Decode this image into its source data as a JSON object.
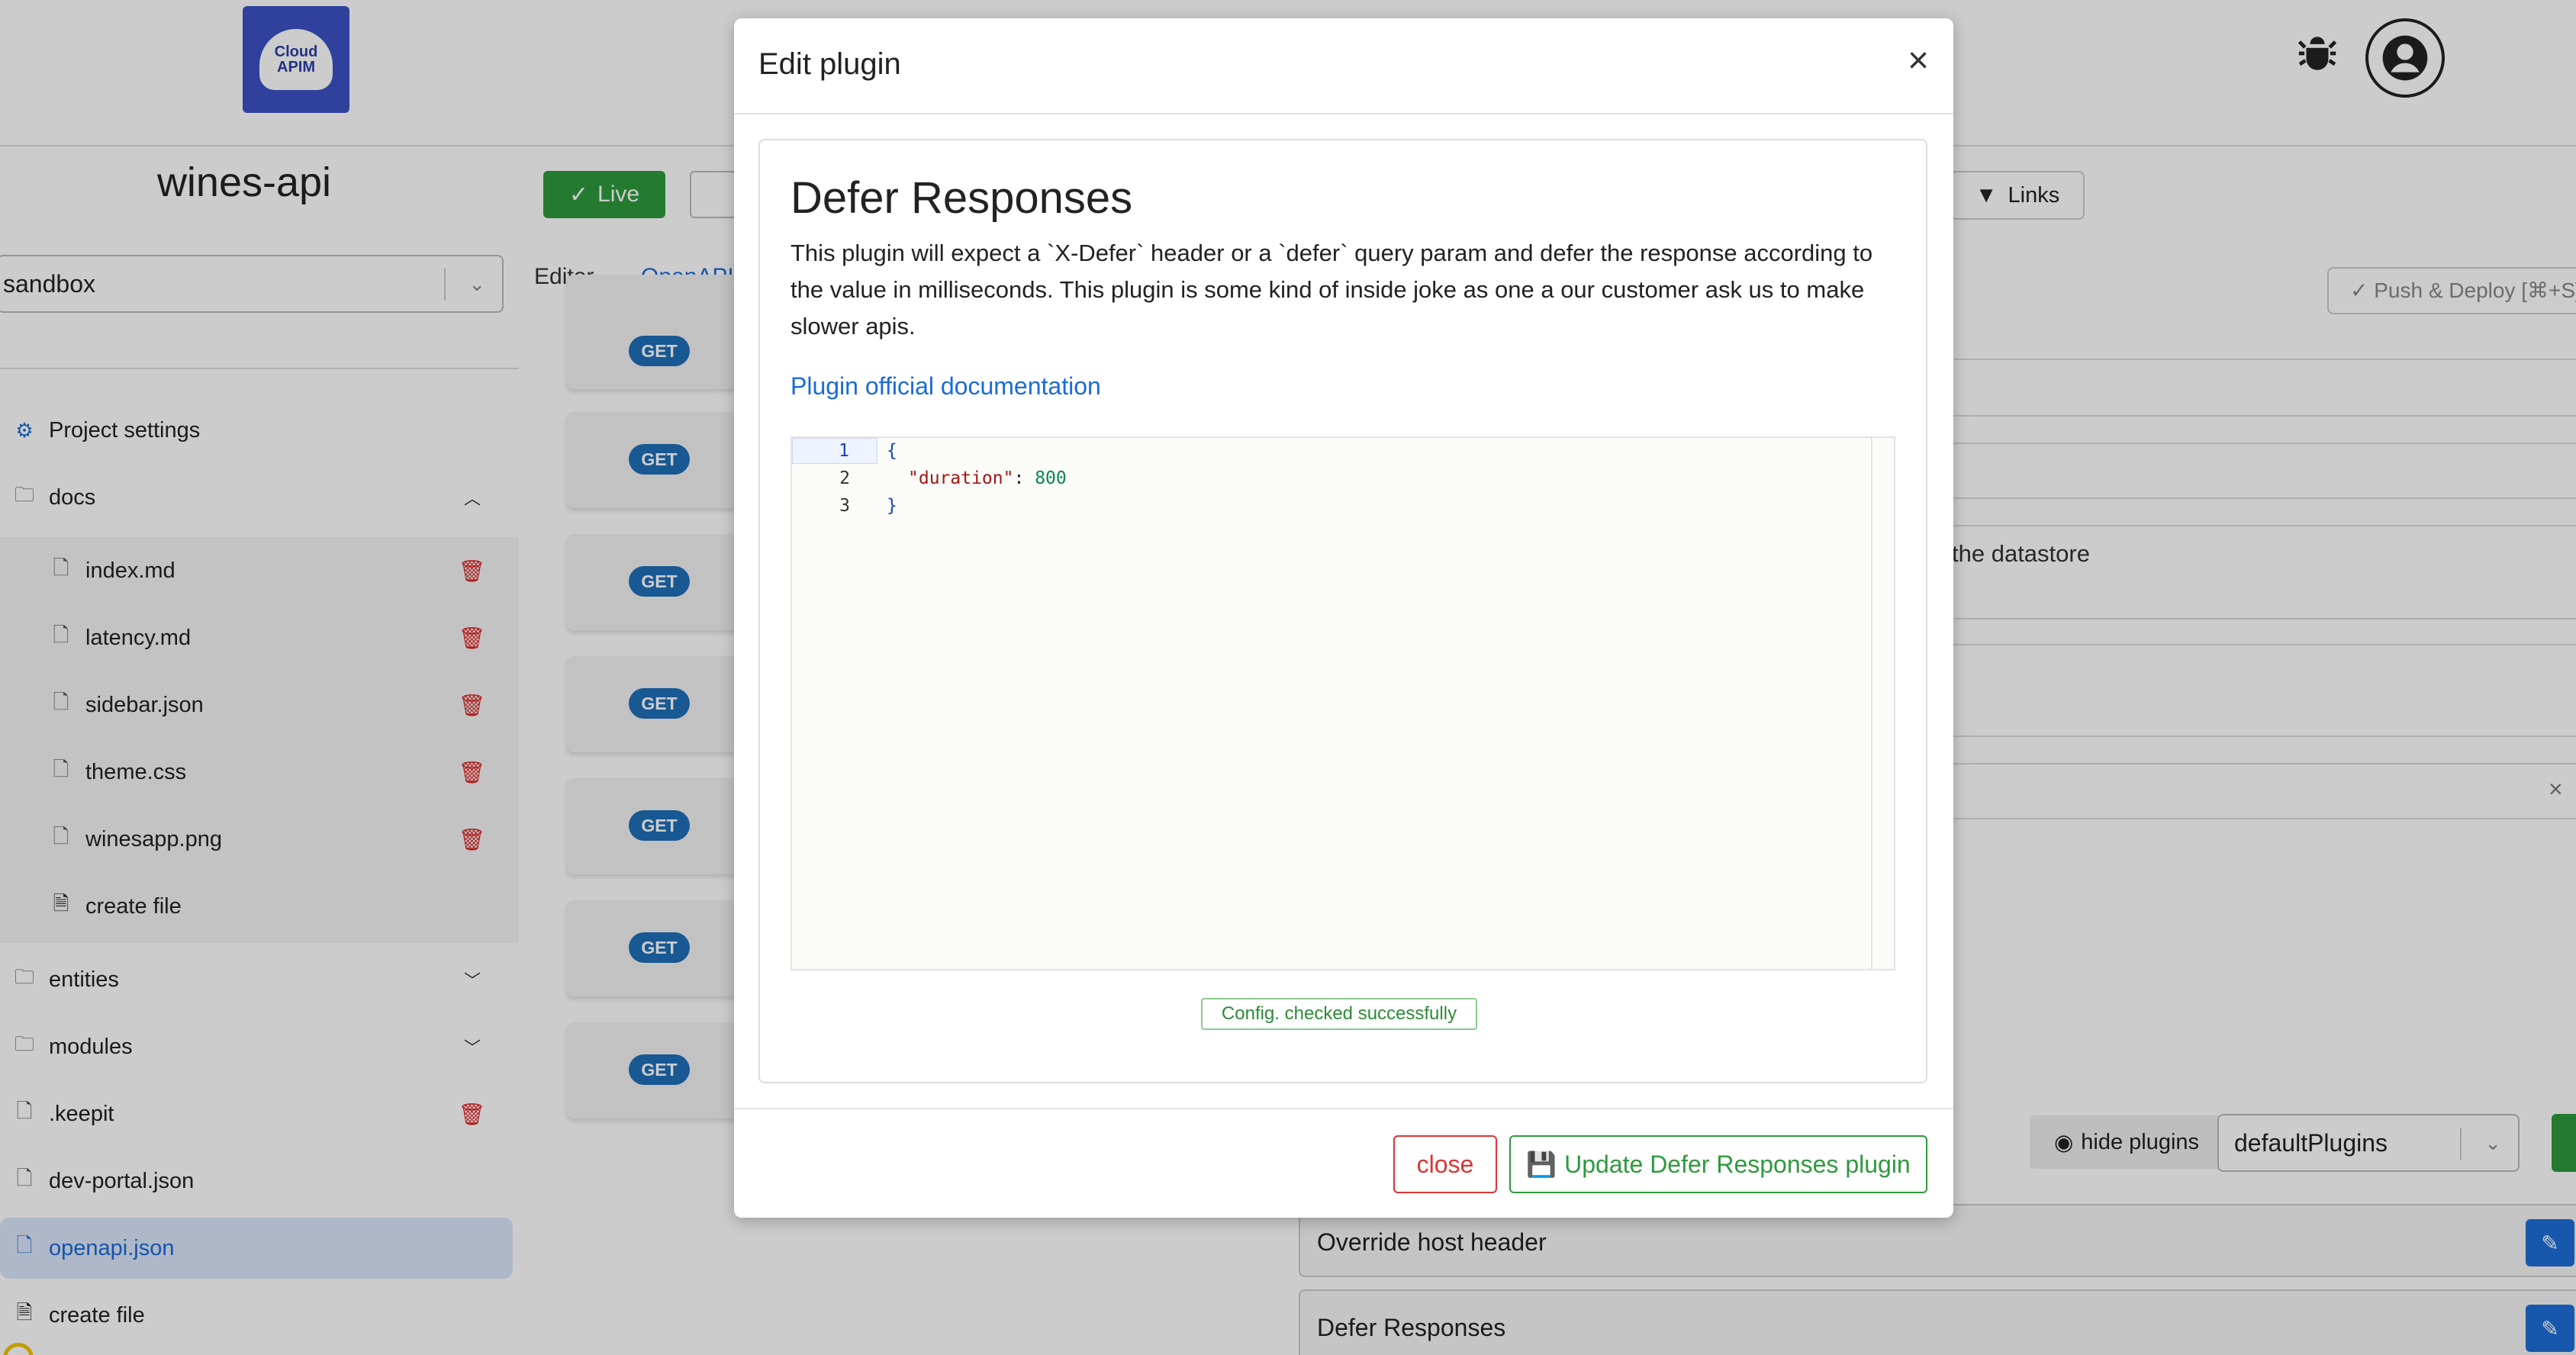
{
  "header": {
    "logo_text_line1": "Cloud",
    "logo_text_line2": "APIM"
  },
  "project": {
    "title": "wines-api",
    "environment": "sandbox"
  },
  "toolbar": {
    "live_label": "Live",
    "links_label": "Links",
    "push_label": "Push & Deploy [⌘+S]"
  },
  "tabs": [
    {
      "label": "Editor"
    },
    {
      "label": "OpenAPI"
    }
  ],
  "sidebar": {
    "items": [
      {
        "label": "Project settings"
      },
      {
        "label": "docs"
      },
      {
        "label": "index.md"
      },
      {
        "label": "latency.md"
      },
      {
        "label": "sidebar.json"
      },
      {
        "label": "theme.css"
      },
      {
        "label": "winesapp.png"
      },
      {
        "label": "create file"
      },
      {
        "label": "entities"
      },
      {
        "label": "modules"
      },
      {
        "label": ".keepit"
      },
      {
        "label": "dev-portal.json"
      },
      {
        "label": "openapi.json"
      },
      {
        "label": "create file"
      }
    ]
  },
  "routes": {
    "method": "GET"
  },
  "right_panel": {
    "datastore_text": "the datastore",
    "hide_plugins_label": "hide plugins",
    "plugin_set": "defaultPlugins",
    "plugins": [
      {
        "name": "Override host header"
      },
      {
        "name": "Defer Responses"
      }
    ]
  },
  "modal": {
    "title": "Edit plugin",
    "plugin_name": "Defer Responses",
    "description": "This plugin will expect a `X-Defer` header or a `defer` query param and defer the response according to the value in milliseconds. This plugin is some kind of inside joke as one a our customer ask us to make slower apis.",
    "doc_link": "Plugin official documentation",
    "code_lines": [
      {
        "n": "1"
      },
      {
        "n": "2"
      },
      {
        "n": "3"
      }
    ],
    "code_open": "{",
    "code_key": "\"duration\"",
    "code_colon": ": ",
    "code_value": "800",
    "code_close": "}",
    "config_status": "Config. checked successfully",
    "close_label": "close",
    "update_label": "Update Defer Responses plugin"
  }
}
